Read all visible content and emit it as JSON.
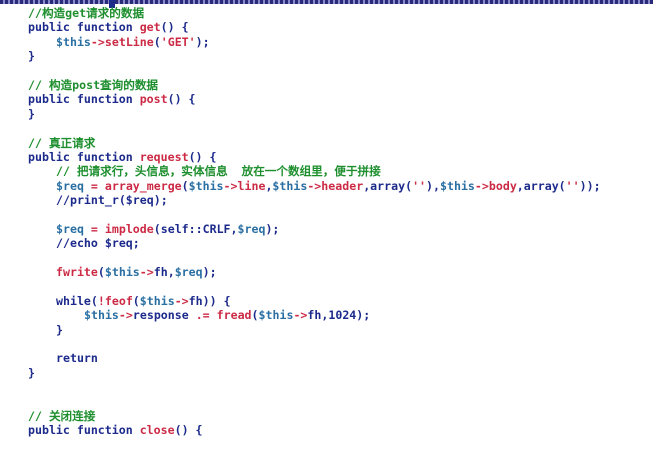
{
  "editor": {
    "cursor_line": 1,
    "lines": [
      {
        "indent": 0,
        "tokens": [
          {
            "t": "//构造get请求的数据",
            "c": "cmt"
          }
        ]
      },
      {
        "indent": 0,
        "tokens": [
          {
            "t": "public function ",
            "c": "kw"
          },
          {
            "t": "get",
            "c": "fn"
          },
          {
            "t": "() {",
            "c": "pl"
          }
        ]
      },
      {
        "indent": 4,
        "tokens": [
          {
            "t": "$this",
            "c": "var"
          },
          {
            "t": "->",
            "c": "op"
          },
          {
            "t": "setLine",
            "c": "fn"
          },
          {
            "t": "(",
            "c": "pl"
          },
          {
            "t": "'GET'",
            "c": "str"
          },
          {
            "t": ");",
            "c": "pl"
          }
        ]
      },
      {
        "indent": 0,
        "tokens": [
          {
            "t": "}",
            "c": "pl"
          }
        ]
      },
      {
        "indent": 0,
        "tokens": []
      },
      {
        "indent": 0,
        "tokens": [
          {
            "t": "// 构造post查询的数据",
            "c": "cmt"
          }
        ]
      },
      {
        "indent": 0,
        "tokens": [
          {
            "t": "public function ",
            "c": "kw"
          },
          {
            "t": "post",
            "c": "fn"
          },
          {
            "t": "() {",
            "c": "pl"
          }
        ]
      },
      {
        "indent": 0,
        "tokens": [
          {
            "t": "}",
            "c": "pl"
          }
        ]
      },
      {
        "indent": 0,
        "tokens": []
      },
      {
        "indent": 0,
        "tokens": [
          {
            "t": "// 真正请求",
            "c": "cmt"
          }
        ]
      },
      {
        "indent": 0,
        "tokens": [
          {
            "t": "public function ",
            "c": "kw"
          },
          {
            "t": "request",
            "c": "fn"
          },
          {
            "t": "() {",
            "c": "pl"
          }
        ]
      },
      {
        "indent": 4,
        "tokens": [
          {
            "t": "// 把请求行，头信息，实体信息  放在一个数组里，便于拼接",
            "c": "cmt"
          }
        ]
      },
      {
        "indent": 4,
        "tokens": [
          {
            "t": "$req",
            "c": "var"
          },
          {
            "t": " = ",
            "c": "op"
          },
          {
            "t": "array_merge",
            "c": "fn"
          },
          {
            "t": "(",
            "c": "pl"
          },
          {
            "t": "$this",
            "c": "var"
          },
          {
            "t": "->",
            "c": "op"
          },
          {
            "t": "line",
            "c": "fn"
          },
          {
            "t": ",",
            "c": "pl"
          },
          {
            "t": "$this",
            "c": "var"
          },
          {
            "t": "->",
            "c": "op"
          },
          {
            "t": "header",
            "c": "fn"
          },
          {
            "t": ",array(",
            "c": "pl"
          },
          {
            "t": "''",
            "c": "str"
          },
          {
            "t": "),",
            "c": "pl"
          },
          {
            "t": "$this",
            "c": "var"
          },
          {
            "t": "->",
            "c": "op"
          },
          {
            "t": "body",
            "c": "fn"
          },
          {
            "t": ",array(",
            "c": "pl"
          },
          {
            "t": "''",
            "c": "str"
          },
          {
            "t": "));",
            "c": "pl"
          }
        ]
      },
      {
        "indent": 4,
        "tokens": [
          {
            "t": "//print_r($req);",
            "c": "pl"
          }
        ]
      },
      {
        "indent": 0,
        "tokens": []
      },
      {
        "indent": 4,
        "tokens": [
          {
            "t": "$req",
            "c": "var"
          },
          {
            "t": " = ",
            "c": "op"
          },
          {
            "t": "implode",
            "c": "fn"
          },
          {
            "t": "(self::CRLF,",
            "c": "pl"
          },
          {
            "t": "$req",
            "c": "var"
          },
          {
            "t": ");",
            "c": "pl"
          }
        ]
      },
      {
        "indent": 4,
        "tokens": [
          {
            "t": "//echo $req;",
            "c": "pl"
          }
        ]
      },
      {
        "indent": 0,
        "tokens": []
      },
      {
        "indent": 4,
        "tokens": [
          {
            "t": "fwrite",
            "c": "fn"
          },
          {
            "t": "(",
            "c": "pl"
          },
          {
            "t": "$this",
            "c": "var"
          },
          {
            "t": "->",
            "c": "op"
          },
          {
            "t": "fh",
            "c": "pl"
          },
          {
            "t": ",",
            "c": "pl"
          },
          {
            "t": "$req",
            "c": "var"
          },
          {
            "t": ");",
            "c": "pl"
          }
        ]
      },
      {
        "indent": 0,
        "tokens": []
      },
      {
        "indent": 4,
        "tokens": [
          {
            "t": "while",
            "c": "kw"
          },
          {
            "t": "(",
            "c": "pl"
          },
          {
            "t": "!",
            "c": "op"
          },
          {
            "t": "feof",
            "c": "fn"
          },
          {
            "t": "(",
            "c": "pl"
          },
          {
            "t": "$this",
            "c": "var"
          },
          {
            "t": "->",
            "c": "op"
          },
          {
            "t": "fh",
            "c": "pl"
          },
          {
            "t": ")) {",
            "c": "pl"
          }
        ]
      },
      {
        "indent": 8,
        "tokens": [
          {
            "t": "$this",
            "c": "var"
          },
          {
            "t": "->",
            "c": "op"
          },
          {
            "t": "response",
            "c": "pl"
          },
          {
            "t": " .= ",
            "c": "op"
          },
          {
            "t": "fread",
            "c": "fn"
          },
          {
            "t": "(",
            "c": "pl"
          },
          {
            "t": "$this",
            "c": "var"
          },
          {
            "t": "->",
            "c": "op"
          },
          {
            "t": "fh",
            "c": "pl"
          },
          {
            "t": ",1024);",
            "c": "pl"
          }
        ]
      },
      {
        "indent": 4,
        "tokens": [
          {
            "t": "}",
            "c": "pl"
          }
        ]
      },
      {
        "indent": 0,
        "tokens": []
      },
      {
        "indent": 4,
        "tokens": [
          {
            "t": "return",
            "c": "kw"
          }
        ]
      },
      {
        "indent": 0,
        "tokens": [
          {
            "t": "}",
            "c": "pl"
          }
        ]
      },
      {
        "indent": 0,
        "tokens": []
      },
      {
        "indent": 0,
        "tokens": []
      },
      {
        "indent": 0,
        "tokens": [
          {
            "t": "// 关闭连接",
            "c": "cmt"
          }
        ]
      },
      {
        "indent": 0,
        "tokens": [
          {
            "t": "public function ",
            "c": "kw"
          },
          {
            "t": "close",
            "c": "fn"
          },
          {
            "t": "() {",
            "c": "pl"
          }
        ]
      }
    ]
  }
}
